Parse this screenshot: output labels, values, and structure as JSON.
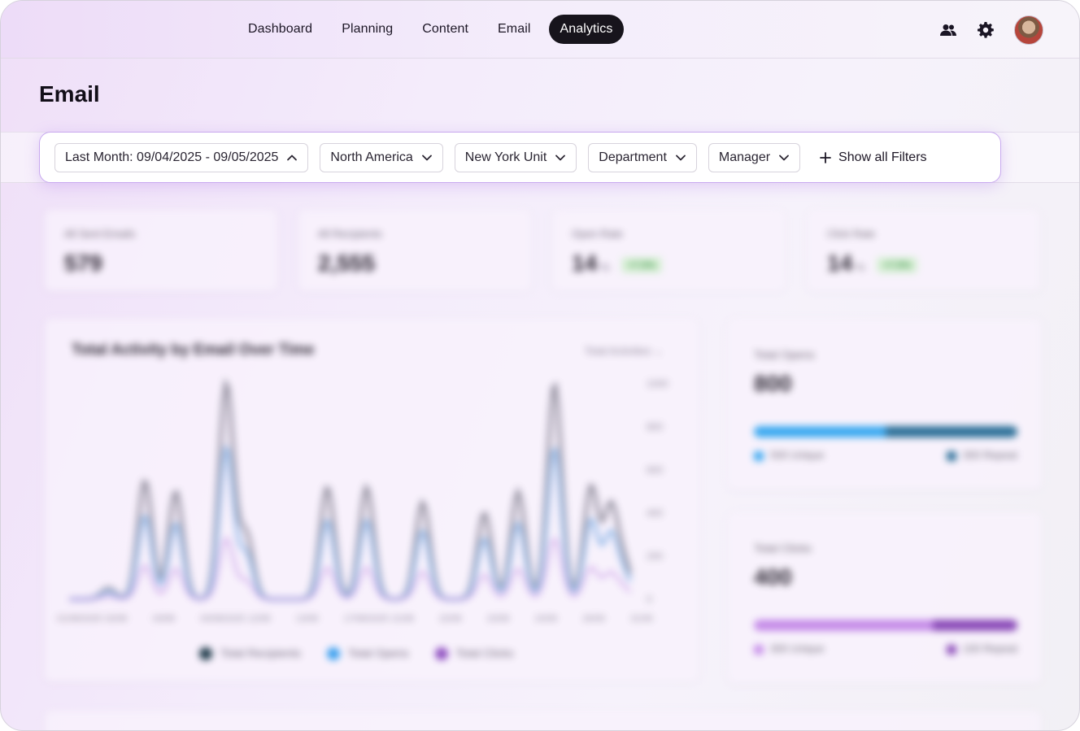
{
  "nav": {
    "items": [
      {
        "label": "Dashboard",
        "active": false
      },
      {
        "label": "Planning",
        "active": false
      },
      {
        "label": "Content",
        "active": false
      },
      {
        "label": "Email",
        "active": false
      },
      {
        "label": "Analytics",
        "active": true
      }
    ],
    "icons": [
      "users-icon",
      "gear-icon"
    ]
  },
  "page": {
    "title": "Email"
  },
  "filters": {
    "date_range": "Last Month: 09/04/2025 -  09/05/2025",
    "region": "North America",
    "unit": "New York Unit",
    "department": "Department",
    "manager": "Manager",
    "show_all": "Show all Filters"
  },
  "kpis": [
    {
      "label": "All Sent Emails",
      "value": "579"
    },
    {
      "label": "All Recipients",
      "value": "2,555"
    },
    {
      "label": "Open Rate",
      "value": "14",
      "unit": "%",
      "badge": "+7.5%"
    },
    {
      "label": "Click Rate",
      "value": "14",
      "unit": "%",
      "badge": "+7.5%"
    }
  ],
  "activity_chart": {
    "title": "Total Activity by Email Over Time",
    "dropdown": "Total Activities",
    "legend": [
      "Total Recipients",
      "Total Opens",
      "Total Clicks"
    ],
    "colors": {
      "recipients": "#8c8897",
      "opens": "#8fb7e6",
      "clicks": "#c79be3"
    },
    "y_ticks": [
      "1000",
      "800",
      "600",
      "400",
      "200",
      "0"
    ],
    "x_ticks": [
      "01/08/2025",
      "02/08",
      "03/08",
      "04/08/2025",
      "12/08",
      "13/08",
      "17/08/2025",
      "21/08",
      "22/08",
      "23/08",
      "24/08",
      "26/08",
      "31/08"
    ]
  },
  "opens_card": {
    "label": "Total Opens",
    "value": "800",
    "unique_label": "500 Unique",
    "repeat_label": "300 Repeat",
    "unique_share": 0.5,
    "colors": {
      "unique": "#3aa9f0",
      "repeat": "#2b6f98"
    }
  },
  "clicks_card": {
    "label": "Total Clicks",
    "value": "400",
    "unique_label": "300 Unique",
    "repeat_label": "100 Repeat",
    "unique_share": 0.68,
    "colors": {
      "unique": "#c58ce8",
      "repeat": "#8a4ab8"
    }
  }
}
